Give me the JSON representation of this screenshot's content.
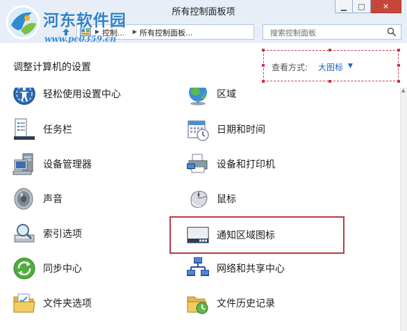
{
  "window": {
    "title": "所有控制面板项",
    "controls": {
      "minimize": "▁",
      "maximize": "□",
      "close": "✕"
    }
  },
  "watermark": {
    "name": "河东软件园",
    "url": "www.pc0359.cn"
  },
  "address": {
    "crumbs": [
      "控制...",
      "所有控制面板..."
    ],
    "search_placeholder": "搜索控制面板"
  },
  "header": {
    "title": "调整计算机的设置",
    "view_by_label": "查看方式:",
    "view_by_value": "大图标"
  },
  "items": [
    {
      "label": "轻松使用设置中心",
      "icon": "ease-of-access-icon"
    },
    {
      "label": "区域",
      "icon": "region-globe-icon"
    },
    {
      "label": "任务栏",
      "icon": "taskbar-icon"
    },
    {
      "label": "日期和时间",
      "icon": "date-time-icon"
    },
    {
      "label": "设备管理器",
      "icon": "device-manager-icon"
    },
    {
      "label": "设备和打印机",
      "icon": "devices-printers-icon"
    },
    {
      "label": "声音",
      "icon": "speaker-icon"
    },
    {
      "label": "鼠标",
      "icon": "mouse-icon"
    },
    {
      "label": "索引选项",
      "icon": "indexing-icon"
    },
    {
      "label": "通知区域图标",
      "icon": "notification-area-icon"
    },
    {
      "label": "同步中心",
      "icon": "sync-center-icon"
    },
    {
      "label": "网络和共享中心",
      "icon": "network-sharing-icon"
    },
    {
      "label": "文件夹选项",
      "icon": "folder-options-icon"
    },
    {
      "label": "文件历史记录",
      "icon": "file-history-icon"
    }
  ],
  "colors": {
    "chrome": "#e7eef7",
    "link": "#1a66b8",
    "highlight_border": "#b83a45"
  }
}
